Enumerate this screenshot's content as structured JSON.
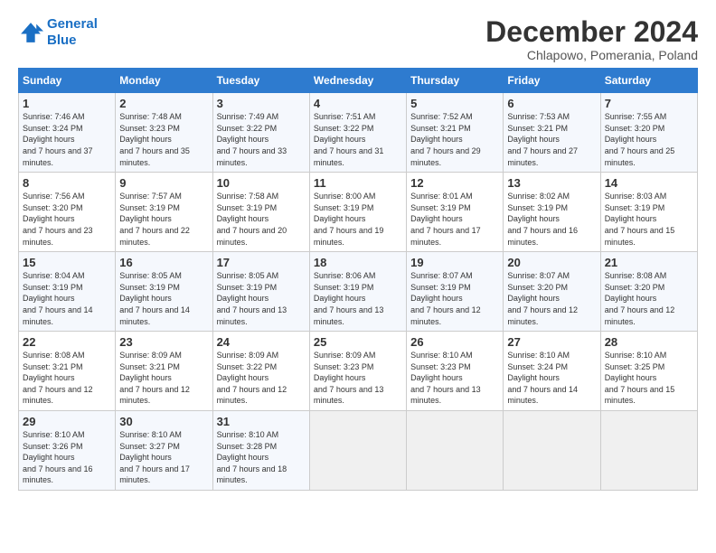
{
  "logo": {
    "line1": "General",
    "line2": "Blue"
  },
  "title": "December 2024",
  "subtitle": "Chlapowo, Pomerania, Poland",
  "days_of_week": [
    "Sunday",
    "Monday",
    "Tuesday",
    "Wednesday",
    "Thursday",
    "Friday",
    "Saturday"
  ],
  "weeks": [
    [
      {
        "day": 1,
        "sunrise": "7:46 AM",
        "sunset": "3:24 PM",
        "daylight": "7 hours and 37 minutes."
      },
      {
        "day": 2,
        "sunrise": "7:48 AM",
        "sunset": "3:23 PM",
        "daylight": "7 hours and 35 minutes."
      },
      {
        "day": 3,
        "sunrise": "7:49 AM",
        "sunset": "3:22 PM",
        "daylight": "7 hours and 33 minutes."
      },
      {
        "day": 4,
        "sunrise": "7:51 AM",
        "sunset": "3:22 PM",
        "daylight": "7 hours and 31 minutes."
      },
      {
        "day": 5,
        "sunrise": "7:52 AM",
        "sunset": "3:21 PM",
        "daylight": "7 hours and 29 minutes."
      },
      {
        "day": 6,
        "sunrise": "7:53 AM",
        "sunset": "3:21 PM",
        "daylight": "7 hours and 27 minutes."
      },
      {
        "day": 7,
        "sunrise": "7:55 AM",
        "sunset": "3:20 PM",
        "daylight": "7 hours and 25 minutes."
      }
    ],
    [
      {
        "day": 8,
        "sunrise": "7:56 AM",
        "sunset": "3:20 PM",
        "daylight": "7 hours and 23 minutes."
      },
      {
        "day": 9,
        "sunrise": "7:57 AM",
        "sunset": "3:19 PM",
        "daylight": "7 hours and 22 minutes."
      },
      {
        "day": 10,
        "sunrise": "7:58 AM",
        "sunset": "3:19 PM",
        "daylight": "7 hours and 20 minutes."
      },
      {
        "day": 11,
        "sunrise": "8:00 AM",
        "sunset": "3:19 PM",
        "daylight": "7 hours and 19 minutes."
      },
      {
        "day": 12,
        "sunrise": "8:01 AM",
        "sunset": "3:19 PM",
        "daylight": "7 hours and 17 minutes."
      },
      {
        "day": 13,
        "sunrise": "8:02 AM",
        "sunset": "3:19 PM",
        "daylight": "7 hours and 16 minutes."
      },
      {
        "day": 14,
        "sunrise": "8:03 AM",
        "sunset": "3:19 PM",
        "daylight": "7 hours and 15 minutes."
      }
    ],
    [
      {
        "day": 15,
        "sunrise": "8:04 AM",
        "sunset": "3:19 PM",
        "daylight": "7 hours and 14 minutes."
      },
      {
        "day": 16,
        "sunrise": "8:05 AM",
        "sunset": "3:19 PM",
        "daylight": "7 hours and 14 minutes."
      },
      {
        "day": 17,
        "sunrise": "8:05 AM",
        "sunset": "3:19 PM",
        "daylight": "7 hours and 13 minutes."
      },
      {
        "day": 18,
        "sunrise": "8:06 AM",
        "sunset": "3:19 PM",
        "daylight": "7 hours and 13 minutes."
      },
      {
        "day": 19,
        "sunrise": "8:07 AM",
        "sunset": "3:19 PM",
        "daylight": "7 hours and 12 minutes."
      },
      {
        "day": 20,
        "sunrise": "8:07 AM",
        "sunset": "3:20 PM",
        "daylight": "7 hours and 12 minutes."
      },
      {
        "day": 21,
        "sunrise": "8:08 AM",
        "sunset": "3:20 PM",
        "daylight": "7 hours and 12 minutes."
      }
    ],
    [
      {
        "day": 22,
        "sunrise": "8:08 AM",
        "sunset": "3:21 PM",
        "daylight": "7 hours and 12 minutes."
      },
      {
        "day": 23,
        "sunrise": "8:09 AM",
        "sunset": "3:21 PM",
        "daylight": "7 hours and 12 minutes."
      },
      {
        "day": 24,
        "sunrise": "8:09 AM",
        "sunset": "3:22 PM",
        "daylight": "7 hours and 12 minutes."
      },
      {
        "day": 25,
        "sunrise": "8:09 AM",
        "sunset": "3:23 PM",
        "daylight": "7 hours and 13 minutes."
      },
      {
        "day": 26,
        "sunrise": "8:10 AM",
        "sunset": "3:23 PM",
        "daylight": "7 hours and 13 minutes."
      },
      {
        "day": 27,
        "sunrise": "8:10 AM",
        "sunset": "3:24 PM",
        "daylight": "7 hours and 14 minutes."
      },
      {
        "day": 28,
        "sunrise": "8:10 AM",
        "sunset": "3:25 PM",
        "daylight": "7 hours and 15 minutes."
      }
    ],
    [
      {
        "day": 29,
        "sunrise": "8:10 AM",
        "sunset": "3:26 PM",
        "daylight": "7 hours and 16 minutes."
      },
      {
        "day": 30,
        "sunrise": "8:10 AM",
        "sunset": "3:27 PM",
        "daylight": "7 hours and 17 minutes."
      },
      {
        "day": 31,
        "sunrise": "8:10 AM",
        "sunset": "3:28 PM",
        "daylight": "7 hours and 18 minutes."
      },
      null,
      null,
      null,
      null
    ]
  ]
}
